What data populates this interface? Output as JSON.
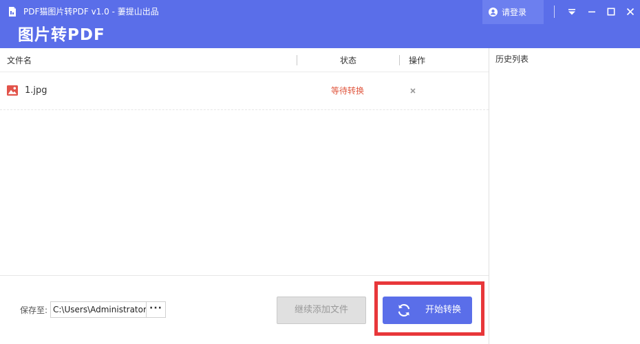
{
  "window": {
    "title": "PDF猫图片转PDF v1.0 - 萋提山出品",
    "app_title": "图片转PDF",
    "login_label": "请登录"
  },
  "table": {
    "headers": {
      "filename": "文件名",
      "status": "状态",
      "action": "操作"
    },
    "rows": [
      {
        "name": "1.jpg",
        "status": "等待转换",
        "action_icon": "close-icon"
      }
    ]
  },
  "bottom": {
    "save_label": "保存至:",
    "save_path": "C:\\Users\\Administrator",
    "browse_label": "···",
    "add_label": "继续添加文件",
    "start_label": "开始转换"
  },
  "history": {
    "title": "历史列表"
  },
  "colors": {
    "accent": "#5a6ee9",
    "status_waiting": "#e0573f",
    "highlight": "#e8373a"
  }
}
